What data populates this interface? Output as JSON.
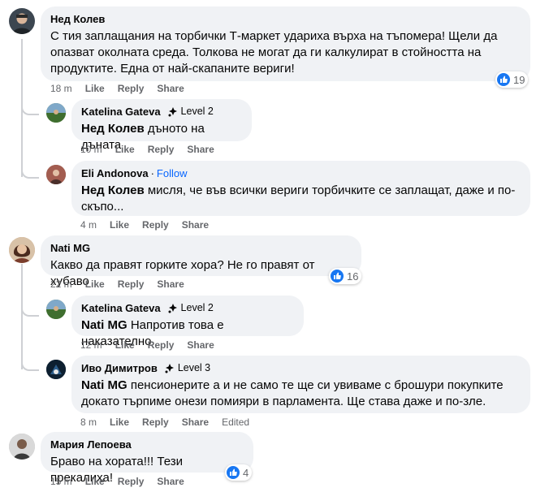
{
  "comments": [
    {
      "author": "Нед Колев",
      "text": "С тия заплащания на торбички Т-маркет удариха върха на тъпомера! Щели да опазват околната среда. Толкова не могат да ги калкулират в стойността на продуктите. Една от най-скапаните вериги!",
      "time": "18 m",
      "like": "Like",
      "reply": "Reply",
      "share": "Share",
      "reactions": "19",
      "replies": [
        {
          "author": "Katelina Gateva",
          "badge": "Level 2",
          "mention": "Нед Колев",
          "text": " дъното на дъната",
          "time": "10 m",
          "like": "Like",
          "reply": "Reply",
          "share": "Share"
        },
        {
          "author": "Eli Andonova",
          "follow": "Follow",
          "mention": "Нед Колев",
          "text": " мисля, че във всички вериги торбичките се заплащат, даже и по-скъпо...",
          "time": "4 m",
          "like": "Like",
          "reply": "Reply",
          "share": "Share"
        }
      ]
    },
    {
      "author": "Nati MG",
      "text": "Какво да правят горките хора? Не го правят от хубаво",
      "time": "22 m",
      "like": "Like",
      "reply": "Reply",
      "share": "Share",
      "reactions": "16",
      "replies": [
        {
          "author": "Katelina Gateva",
          "badge": "Level 2",
          "mention": "Nati MG",
          "text": " Напротив това е наказателно",
          "time": "12 m",
          "like": "Like",
          "reply": "Reply",
          "share": "Share"
        },
        {
          "author": "Иво Димитров",
          "badge": "Level 3",
          "mention": "Nati MG",
          "text": " пенсионерите а и не само те ще си увиваме с брошури покупките докато търпиме онези помияри в парламента. Ще става даже и по-зле.",
          "time": "8 m",
          "like": "Like",
          "reply": "Reply",
          "share": "Share",
          "edited": "Edited"
        }
      ]
    },
    {
      "author": "Мария Лепоева",
      "text": "Браво на хората!!! Тези прекалиха!",
      "time": "15 m",
      "like": "Like",
      "reply": "Reply",
      "share": "Share",
      "reactions": "4"
    }
  ],
  "colors": {
    "bubble": "#f0f2f5",
    "link": "#0866ff",
    "like_blue": "#1877f2",
    "meta": "#65676b"
  },
  "icons": {
    "reaction": "like-thumb-icon",
    "badge": "rising-fan-icon"
  }
}
